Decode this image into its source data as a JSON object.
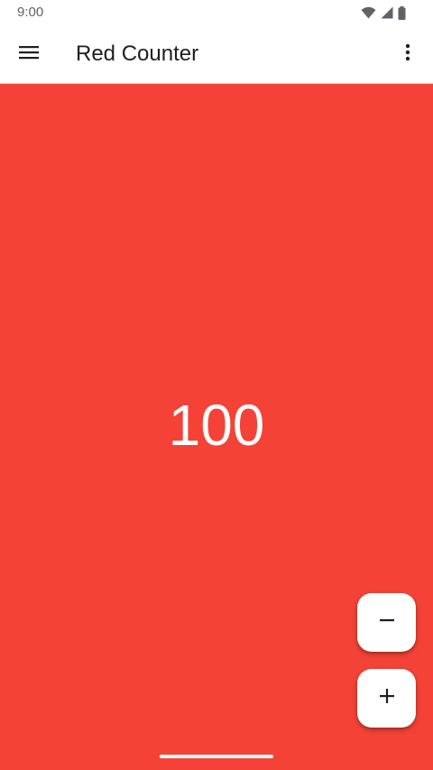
{
  "status_bar": {
    "time": "9:00",
    "icons": [
      "wifi-icon",
      "cellular-signal-icon",
      "battery-icon"
    ]
  },
  "app_bar": {
    "title": "Red Counter",
    "menu_icon": "hamburger-menu-icon",
    "overflow_icon": "more-vert-icon"
  },
  "counter": {
    "value": "100"
  },
  "actions": {
    "decrement_icon": "minus-icon",
    "increment_icon": "plus-icon"
  },
  "colors": {
    "content_background": "#f44336",
    "app_bar_background": "#ffffff",
    "counter_text": "#ffffff",
    "fab_background": "#ffffff"
  }
}
